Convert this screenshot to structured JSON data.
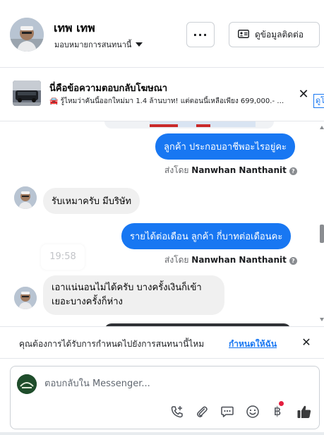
{
  "header": {
    "contact_name": "เทพ เทพ",
    "status": "มอบหมายการสนทนานี้",
    "more_label": "···",
    "contact_info_label": "ดูข้อมูลติดต่อ"
  },
  "ad_banner": {
    "title": "นี่คือข้อความตอบกลับโฆษณา",
    "text": "🚘 รู้ไหมว่าคันนี้ออกใหม่มา 1.4 ล้านบาท! แต่ตอนนี้เหลือเพียง 699,000.- …",
    "link_label": "ดูโ",
    "close_label": "✕"
  },
  "messages": [
    {
      "direction": "out",
      "text": "ลูกค้า ประกอบอาชีพอะไรอยู่คะ"
    },
    {
      "direction": "out_sent_by",
      "prefix": "ส่งโดย",
      "name": "Nanwhan Nanthanit",
      "help": "?"
    },
    {
      "direction": "in",
      "text": "รับเหมาครับ มีบริษัท"
    },
    {
      "direction": "out",
      "text": "รายได้ต่อเดือน ลูกค้า  กี่บาทต่อเดือนคะ"
    },
    {
      "direction": "out_sent_by",
      "prefix": "ส่งโดย",
      "name": "Nanwhan Nanthanit",
      "help": "?"
    },
    {
      "direction": "in",
      "text": "เอาแน่นอนไม่ได้ครับ บางครั้งเงินก็เข้าเยอะบางครั้งก็ห่าง"
    }
  ],
  "timestamp": "19:58",
  "assign_bar": {
    "text": "คุณต้องการได้รับการกำหนดไปยังการสนทนานี้ไหม",
    "link": "กำหนดให้ฉัน",
    "close_label": "✕"
  },
  "composer": {
    "placeholder": "ตอบกลับใน Messenger...",
    "baht_symbol": "฿",
    "icons": [
      "call-add-icon",
      "attachment-icon",
      "saved-reply-icon",
      "emoji-icon",
      "payment-icon",
      "like-icon"
    ]
  },
  "colors": {
    "accent": "#1877f2",
    "incoming_bubble": "#f0f0f0",
    "notification_dot": "#e41e3f"
  }
}
